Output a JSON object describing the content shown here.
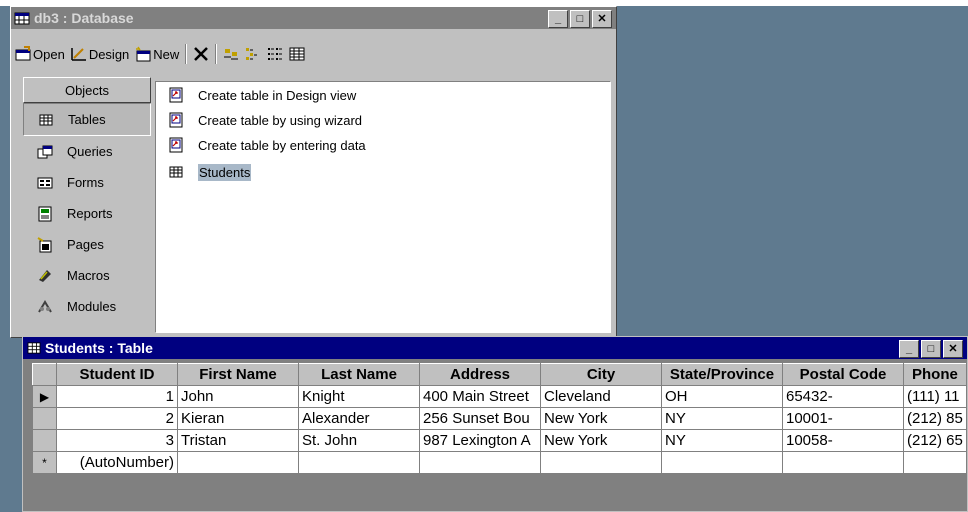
{
  "db_window": {
    "title": "db3 : Database",
    "toolbar": {
      "open_label": "Open",
      "design_label": "Design",
      "new_label": "New"
    },
    "objects_header": "Objects",
    "objects": [
      {
        "label": "Tables",
        "icon": "table-icon"
      },
      {
        "label": "Queries",
        "icon": "query-icon"
      },
      {
        "label": "Forms",
        "icon": "form-icon"
      },
      {
        "label": "Reports",
        "icon": "report-icon"
      },
      {
        "label": "Pages",
        "icon": "page-icon"
      },
      {
        "label": "Macros",
        "icon": "macro-icon"
      },
      {
        "label": "Modules",
        "icon": "module-icon"
      }
    ],
    "items": [
      {
        "label": "Create table in Design view",
        "icon": "shortcut-icon"
      },
      {
        "label": "Create table by using wizard",
        "icon": "shortcut-icon"
      },
      {
        "label": "Create table by entering data",
        "icon": "shortcut-icon"
      },
      {
        "label": "Students",
        "icon": "table-icon"
      }
    ]
  },
  "table_window": {
    "title": "Students : Table",
    "columns": [
      "Student ID",
      "First Name",
      "Last Name",
      "Address",
      "City",
      "State/Province",
      "Postal Code",
      "Phone"
    ],
    "rows": [
      [
        "1",
        "John",
        "Knight",
        "400 Main Street",
        "Cleveland",
        "OH",
        "65432-",
        "(111) 11"
      ],
      [
        "2",
        "Kieran",
        "Alexander",
        "256 Sunset Bou",
        "New York",
        "NY",
        "10001-",
        "(212) 85"
      ],
      [
        "3",
        "Tristan",
        "St. John",
        "987 Lexington A",
        "New York",
        "NY",
        "10058-",
        "(212) 65"
      ]
    ],
    "new_row_marker": "*",
    "new_row_placeholder": "(AutoNumber)",
    "current_row_marker": "▶"
  },
  "colors": {
    "desktop": "#5f7a8f",
    "active_title": "#000080",
    "inactive_title": "#808080",
    "face": "#c0c0c0"
  }
}
